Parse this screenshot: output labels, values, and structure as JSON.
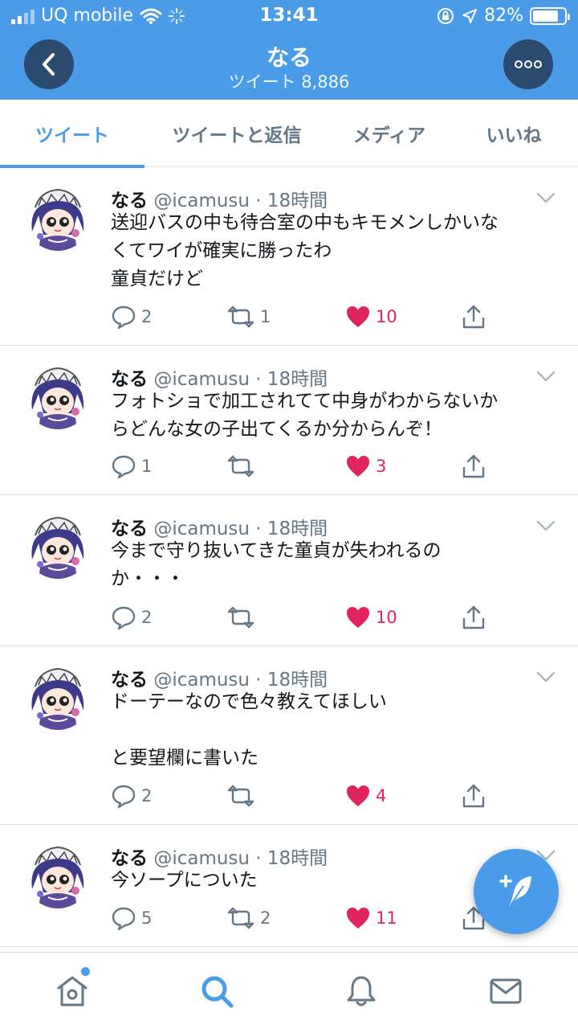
{
  "status_bar": {
    "carrier": "UQ mobile",
    "time": "13:41",
    "battery_percent": "82%",
    "battery_level": 0.82
  },
  "header": {
    "title": "なる",
    "subtitle": "ツイート 8,886"
  },
  "tabs": [
    {
      "label": "ツイート",
      "active": true
    },
    {
      "label": "ツイートと返信",
      "active": false
    },
    {
      "label": "メディア",
      "active": false
    },
    {
      "label": "いいね",
      "active": false
    }
  ],
  "tweets": [
    {
      "name": "なる",
      "meta": "@icamusu · 18時間",
      "text": "送迎バスの中も待合室の中もキモメンしかいな\nくてワイが確実に勝ったわ\n童貞だけど",
      "replies": "2",
      "retweets": "1",
      "likes": "10"
    },
    {
      "name": "なる",
      "meta": "@icamusu · 18時間",
      "text": "フォトショで加工されてて中身がわからないか\nらどんな女の子出てくるか分からんぞ！",
      "replies": "1",
      "retweets": "",
      "likes": "3"
    },
    {
      "name": "なる",
      "meta": "@icamusu · 18時間",
      "text": "今まで守り抜いてきた童貞が失われるの\nか・・・",
      "replies": "2",
      "retweets": "",
      "likes": "10"
    },
    {
      "name": "なる",
      "meta": "@icamusu · 18時間",
      "text": "ドーテーなので色々教えてほしい\n\nと要望欄に書いた",
      "replies": "2",
      "retweets": "",
      "likes": "4"
    },
    {
      "name": "なる",
      "meta": "@icamusu · 18時間",
      "text": "今ソープについた",
      "replies": "5",
      "retweets": "2",
      "likes": "11"
    }
  ],
  "bottom_nav": [
    {
      "icon": "home-icon",
      "has_notification_dot": true
    },
    {
      "icon": "search-icon",
      "active": true
    },
    {
      "icon": "bell-icon"
    },
    {
      "icon": "mail-icon"
    }
  ],
  "colors": {
    "brand_blue": "#4a9be8",
    "like_red": "#e0245e",
    "secondary_text": "#657786"
  }
}
